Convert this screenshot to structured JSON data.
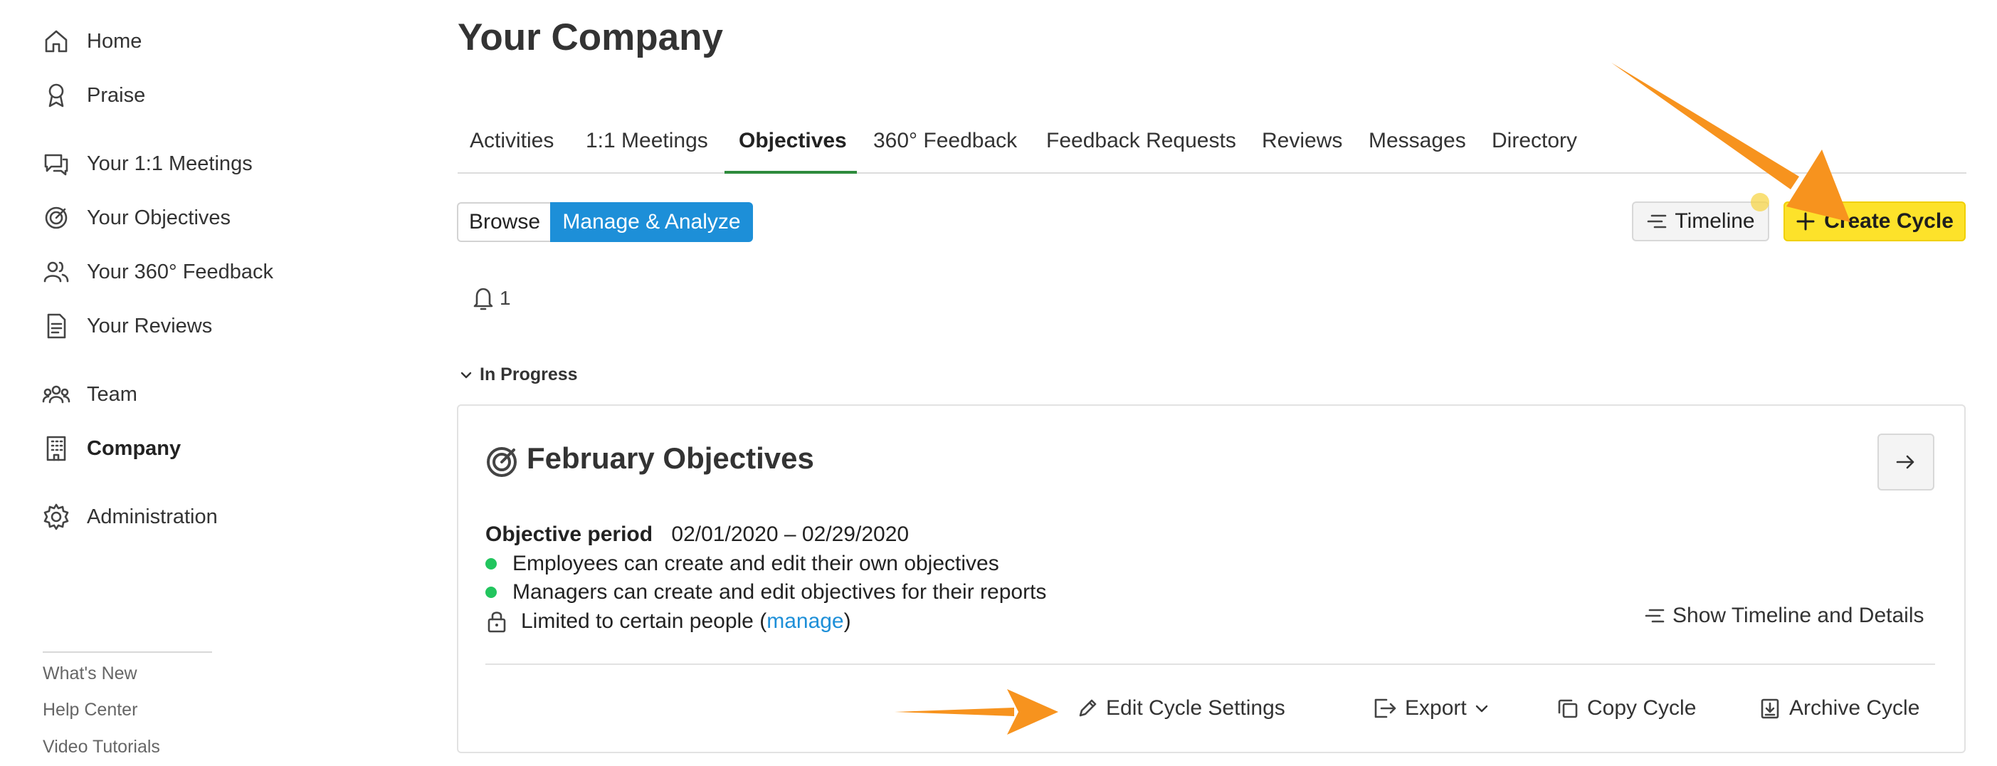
{
  "sidebar": {
    "items": [
      {
        "label": "Home",
        "icon": "home-icon"
      },
      {
        "label": "Praise",
        "icon": "ribbon-icon"
      },
      {
        "label": "Your 1:1 Meetings",
        "icon": "chat-icon"
      },
      {
        "label": "Your Objectives",
        "icon": "target-icon"
      },
      {
        "label": "Your 360° Feedback",
        "icon": "people-icon"
      },
      {
        "label": "Your Reviews",
        "icon": "document-icon"
      },
      {
        "label": "Team",
        "icon": "team-icon"
      },
      {
        "label": "Company",
        "icon": "building-icon"
      },
      {
        "label": "Administration",
        "icon": "gear-icon"
      }
    ],
    "active": "Company",
    "footer": [
      "What's New",
      "Help Center",
      "Video Tutorials"
    ]
  },
  "header": {
    "title": "Your Company",
    "tabs": [
      "Activities",
      "1:1 Meetings",
      "Objectives",
      "360° Feedback",
      "Feedback Requests",
      "Reviews",
      "Messages",
      "Directory"
    ],
    "active_tab": "Objectives"
  },
  "toolbar": {
    "browse_label": "Browse",
    "manage_label": "Manage & Analyze",
    "timeline_label": "Timeline",
    "create_label": "Create Cycle"
  },
  "notifications": {
    "count": "1"
  },
  "section": {
    "label": "In Progress"
  },
  "cycle": {
    "title": "February Objectives",
    "period_label": "Objective period",
    "period_value": "02/01/2020 – 02/29/2020",
    "rules": [
      "Employees can create and edit their own objectives",
      "Managers can create and edit objectives for their reports"
    ],
    "access_prefix": "Limited to certain people (",
    "access_link": "manage",
    "access_suffix": ")",
    "show_details": "Show Timeline and Details",
    "actions": {
      "edit": "Edit Cycle Settings",
      "export": "Export",
      "copy": "Copy Cycle",
      "archive": "Archive Cycle"
    }
  },
  "colors": {
    "primary": "#1d8fd8",
    "create_button": "#fde22a",
    "tab_underline": "#2e8b3c",
    "status_dot": "#22c55e",
    "annotation_arrow": "#f7931e"
  }
}
